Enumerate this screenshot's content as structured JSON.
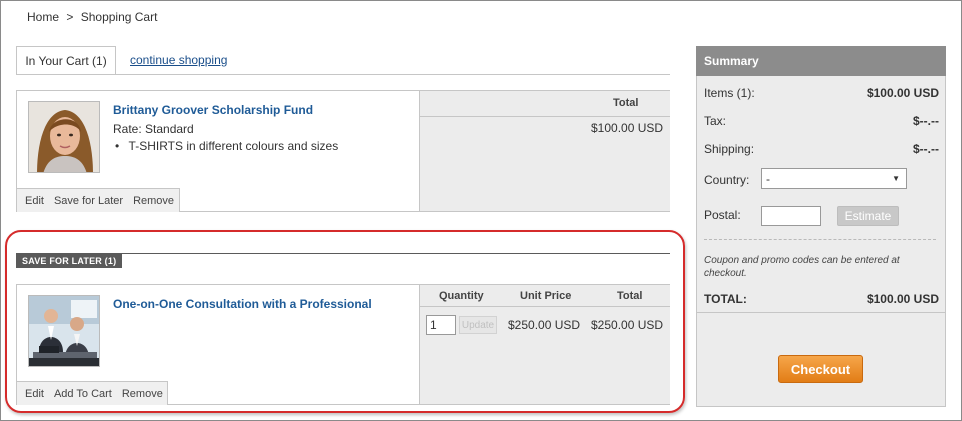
{
  "breadcrumb": {
    "home": "Home",
    "separator": ">",
    "current": "Shopping Cart"
  },
  "tabs": {
    "cart_tab": "In Your Cart (1)",
    "continue_link": "continue shopping"
  },
  "cart_item": {
    "title": "Brittany Groover Scholarship Fund",
    "rate": "Rate: Standard",
    "bullet": "T-SHIRTS in different colours and sizes",
    "total_header": "Total",
    "total_value": "$100.00 USD",
    "actions": [
      "Edit",
      "Save for Later",
      "Remove"
    ]
  },
  "save_for_later": {
    "label": "SAVE FOR LATER (1)",
    "title": "One-on-One Consultation with a Professional",
    "headers": {
      "quantity": "Quantity",
      "unit_price": "Unit Price",
      "total": "Total"
    },
    "quantity": "1",
    "update_label": "Update",
    "unit_price": "$250.00 USD",
    "total": "$250.00 USD",
    "actions": [
      "Edit",
      "Add To Cart",
      "Remove"
    ]
  },
  "summary": {
    "title": "Summary",
    "items_label": "Items (1):",
    "items_value": "$100.00 USD",
    "tax_label": "Tax:",
    "tax_value": "$--.--",
    "shipping_label": "Shipping:",
    "shipping_value": "$--.--",
    "country_label": "Country:",
    "country_value": "-",
    "postal_label": "Postal:",
    "estimate_label": "Estimate",
    "coupon_note": "Coupon and promo codes can be entered at checkout.",
    "total_label": "TOTAL:",
    "total_value": "$100.00 USD",
    "checkout_label": "Checkout"
  },
  "colors": {
    "link": "#1f5b97",
    "summary_header": "#8c8c8c",
    "checkout": "#e88a22",
    "highlight_outline": "#d52b2b"
  }
}
